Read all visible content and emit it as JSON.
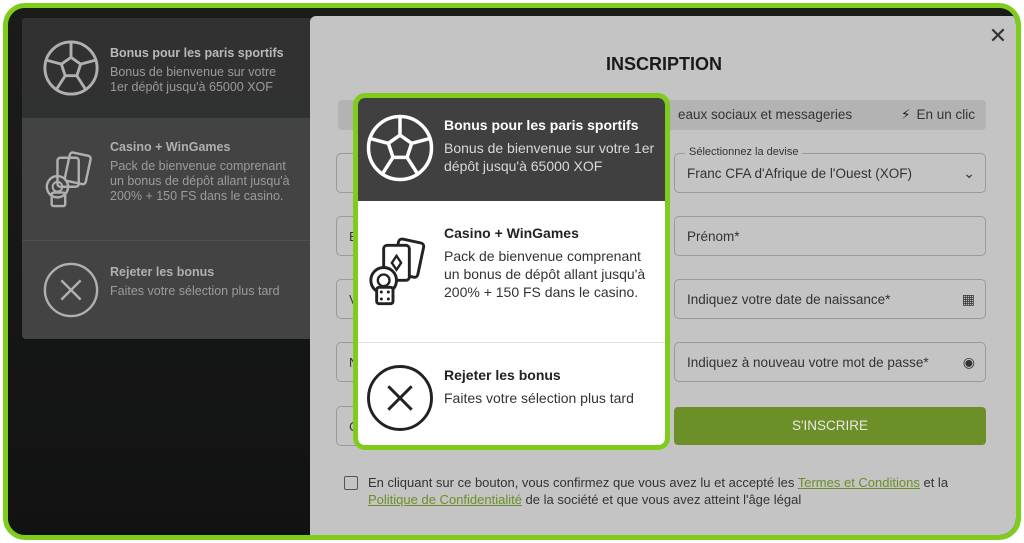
{
  "bonus_options": [
    {
      "icon": "soccer-ball-icon",
      "title": "Bonus pour les paris sportifs",
      "description": "Bonus de bienvenue sur votre 1er dépôt jusqu'à 65000 XOF"
    },
    {
      "icon": "casino-chips-cards-icon",
      "title": "Casino + WinGames",
      "description": "Pack de bienvenue comprenant un bonus de dépôt allant jusqu'à 200% + 150 FS dans le casino."
    },
    {
      "icon": "close-circle-icon",
      "title": "Rejeter les bonus",
      "description": "Faites votre sélection plus tard"
    }
  ],
  "modal": {
    "title": "INSCRIPTION",
    "close_label": "✕",
    "tabs": {
      "social": "eaux sociaux et messageries",
      "oneclick": "En un clic"
    },
    "fields": {
      "currency_label": "Sélectionnez la devise",
      "currency_value": "Franc CFA d'Afrique de l'Ouest (XOF)",
      "first_name": "Prénom*",
      "birth_date": "Indiquez votre date de naissance*",
      "confirm_password": "Indiquez à nouveau votre mot de passe*"
    },
    "left_stubs": [
      "E",
      "V",
      "N",
      "C"
    ],
    "submit_label": "S'INSCRIRE",
    "consent": {
      "before": "En cliquant sur ce bouton, vous confirmez que vous avez lu et accepté les ",
      "terms_link": "Termes et Conditions",
      "middle": " et la ",
      "privacy_link": "Politique de Confidentialité",
      "after": " de la société et que vous avez atteint l'âge légal"
    }
  },
  "colors": {
    "accent_green": "#7fcc1a",
    "submit_green": "#6d8f28",
    "dark_item": "#404040"
  }
}
